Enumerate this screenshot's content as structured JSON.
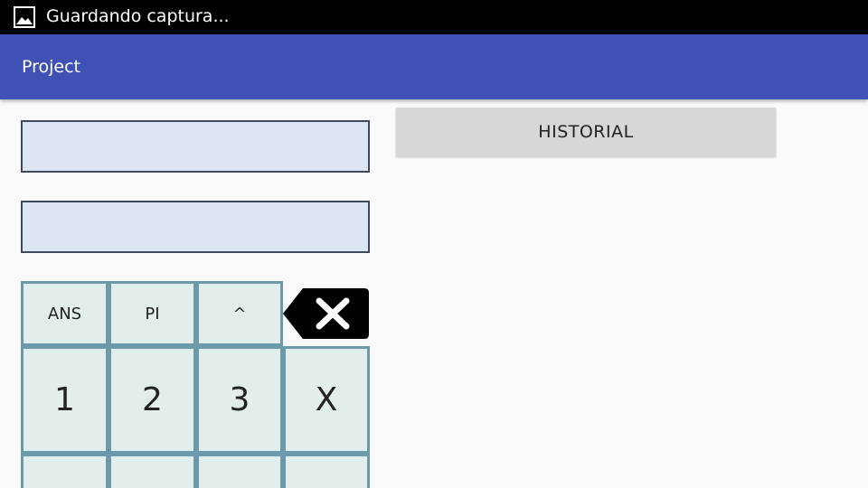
{
  "status_bar": {
    "icon": "image-icon",
    "text": "Guardando captura..."
  },
  "app_bar": {
    "title": "Project"
  },
  "inputs": {
    "first_value": "",
    "second_value": ""
  },
  "history_button": {
    "label": "HISTORIAL"
  },
  "keypad": {
    "row1": [
      "ANS",
      "PI",
      "^"
    ],
    "backspace_icon": "backspace-icon",
    "row2": [
      "1",
      "2",
      "3",
      "X"
    ],
    "row3": [
      "",
      "",
      "",
      ""
    ]
  },
  "colors": {
    "status_bar": "#000000",
    "app_bar": "#3f51b5",
    "input_background": "#dce6f2",
    "key_background": "#e2eeee",
    "key_border": "#6d9aaa",
    "history_button": "#d6d7d7"
  }
}
